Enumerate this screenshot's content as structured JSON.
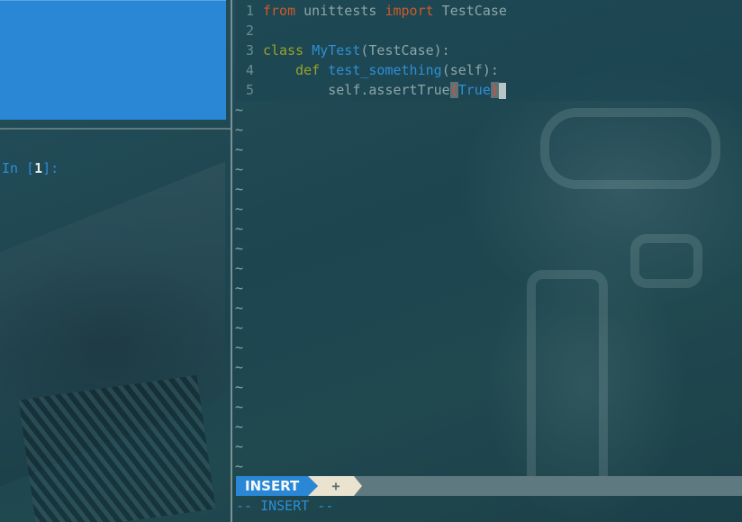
{
  "ipython": {
    "prompt_prefix": "In [",
    "prompt_number": "1",
    "prompt_suffix": "]:"
  },
  "editor": {
    "lines": [
      {
        "num": "1",
        "t1": "from",
        "t2": " unittests ",
        "t3": "import",
        "t4": " TestCase"
      },
      {
        "num": "2"
      },
      {
        "num": "3",
        "t1": "class",
        "t2": " ",
        "t3": "MyTest",
        "t4": "(TestCase):"
      },
      {
        "num": "4",
        "indent": "    ",
        "t1": "def",
        "t2": " ",
        "t3": "test_something",
        "t4": "(self):"
      },
      {
        "num": "5",
        "indent": "        ",
        "t1": "self.assertTrue",
        "t2": "(",
        "t3": "True",
        "t4": ")"
      }
    ],
    "empty_line_marker": "~"
  },
  "statusline": {
    "mode": "INSERT",
    "modified": "+"
  },
  "cmdline": {
    "text": "-- INSERT --"
  },
  "colors": {
    "accent_blue": "#2a87d6",
    "keyword_orange": "#cc5a2a",
    "keyword_green": "#9aa229",
    "background": "#1f4b56"
  }
}
